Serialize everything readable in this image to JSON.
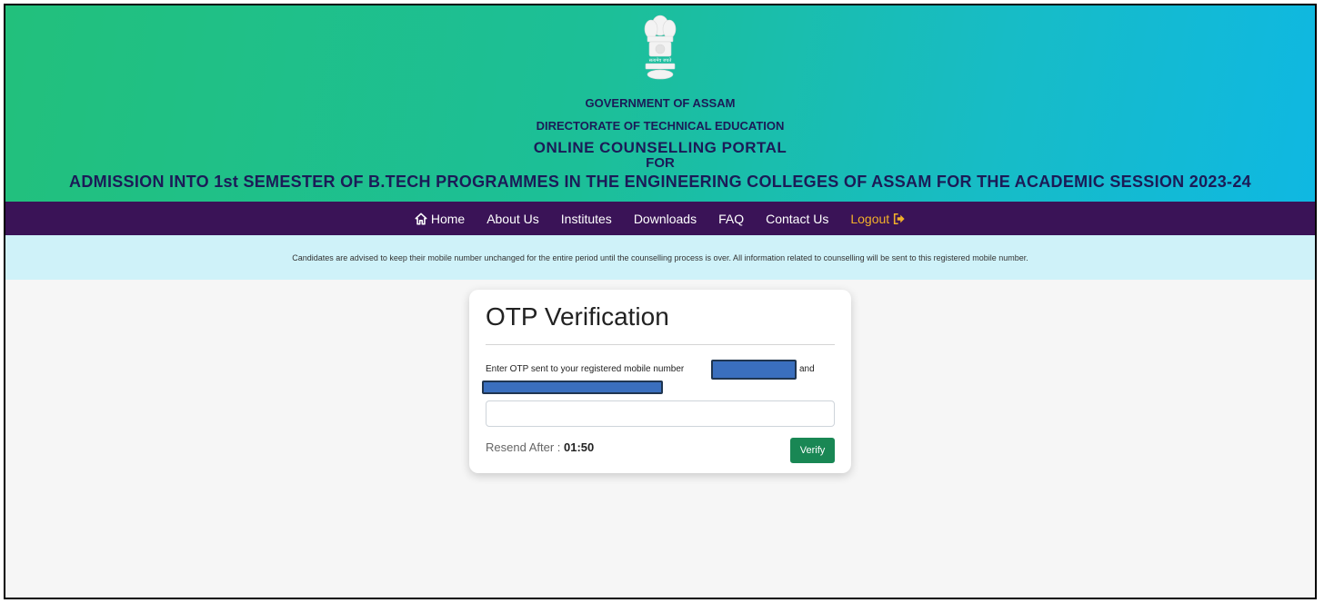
{
  "banner": {
    "line1": "GOVERNMENT OF ASSAM",
    "line2": "DIRECTORATE OF TECHNICAL EDUCATION",
    "line3": "ONLINE COUNSELLING PORTAL",
    "line4": "FOR",
    "line5": "ADMISSION INTO 1st SEMESTER OF B.TECH PROGRAMMES IN THE ENGINEERING COLLEGES OF ASSAM FOR THE ACADEMIC SESSION 2023-24",
    "emblem_motto": "सत्यमेव जयते"
  },
  "nav": {
    "home": "Home",
    "about": "About Us",
    "institutes": "Institutes",
    "downloads": "Downloads",
    "faq": "FAQ",
    "contact": "Contact Us",
    "logout": "Logout"
  },
  "notice": "Candidates are advised to keep their mobile number unchanged for the entire period until the counselling process is over. All information related to counselling will be sent to this registered mobile number.",
  "otp": {
    "title": "OTP Verification",
    "message": "Enter OTP sent to your registered mobile number",
    "and_text": "and",
    "input_value": "",
    "resend_label": "Resend After :",
    "resend_time": "01:50",
    "verify_label": "Verify"
  },
  "colors": {
    "navbar": "#3a1357",
    "logout": "#f2b02a",
    "notice_bg": "#cff2f9",
    "verify": "#198754",
    "banner_text": "#1b1b57"
  }
}
